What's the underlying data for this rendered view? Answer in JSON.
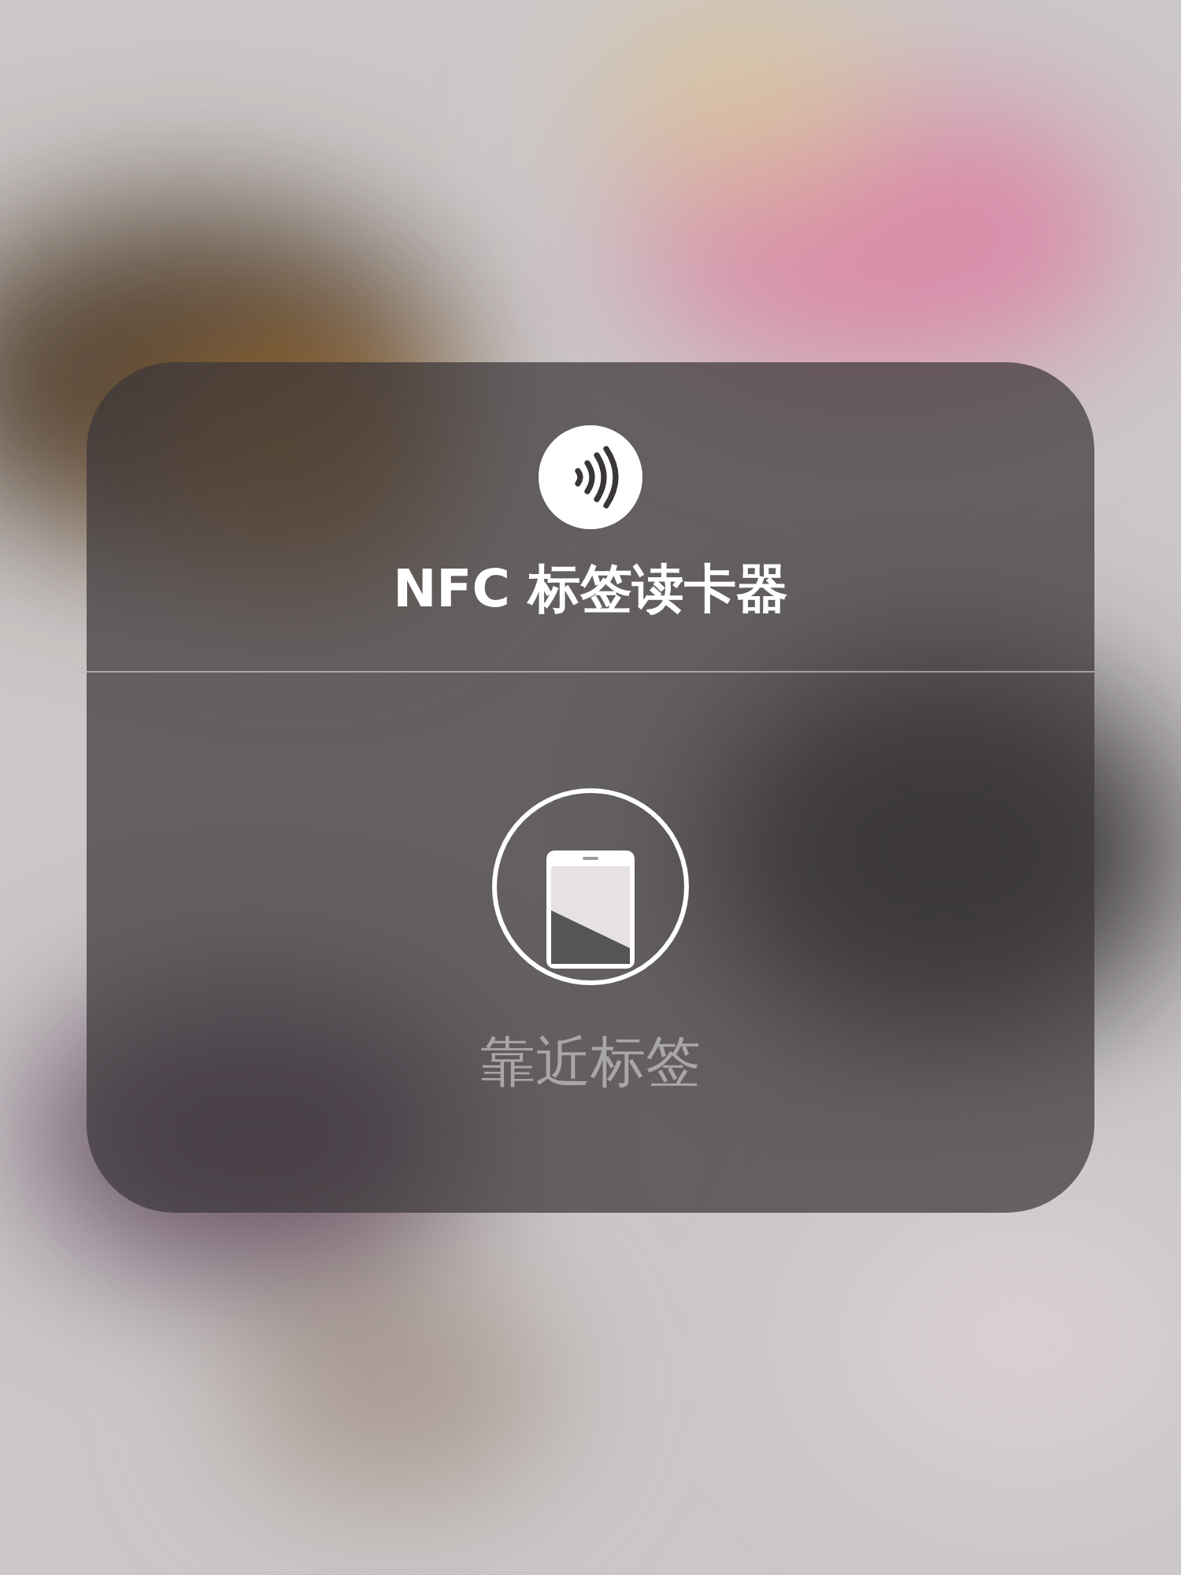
{
  "sheet": {
    "title": "NFC 标签读卡器",
    "prompt": "靠近标签"
  }
}
